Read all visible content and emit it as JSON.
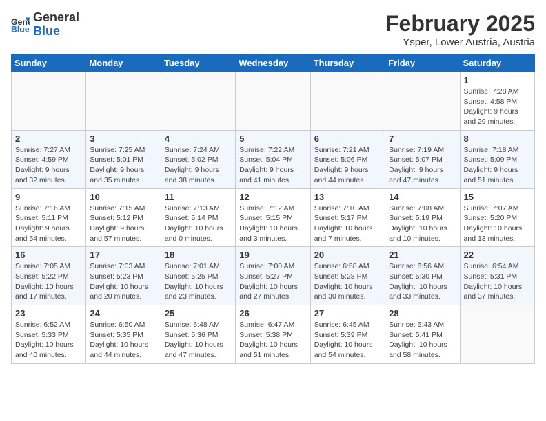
{
  "header": {
    "logo_line1": "General",
    "logo_line2": "Blue",
    "month": "February 2025",
    "location": "Ysper, Lower Austria, Austria"
  },
  "weekdays": [
    "Sunday",
    "Monday",
    "Tuesday",
    "Wednesday",
    "Thursday",
    "Friday",
    "Saturday"
  ],
  "weeks": [
    [
      {
        "day": "",
        "info": ""
      },
      {
        "day": "",
        "info": ""
      },
      {
        "day": "",
        "info": ""
      },
      {
        "day": "",
        "info": ""
      },
      {
        "day": "",
        "info": ""
      },
      {
        "day": "",
        "info": ""
      },
      {
        "day": "1",
        "info": "Sunrise: 7:28 AM\nSunset: 4:58 PM\nDaylight: 9 hours and 29 minutes."
      }
    ],
    [
      {
        "day": "2",
        "info": "Sunrise: 7:27 AM\nSunset: 4:59 PM\nDaylight: 9 hours and 32 minutes."
      },
      {
        "day": "3",
        "info": "Sunrise: 7:25 AM\nSunset: 5:01 PM\nDaylight: 9 hours and 35 minutes."
      },
      {
        "day": "4",
        "info": "Sunrise: 7:24 AM\nSunset: 5:02 PM\nDaylight: 9 hours and 38 minutes."
      },
      {
        "day": "5",
        "info": "Sunrise: 7:22 AM\nSunset: 5:04 PM\nDaylight: 9 hours and 41 minutes."
      },
      {
        "day": "6",
        "info": "Sunrise: 7:21 AM\nSunset: 5:06 PM\nDaylight: 9 hours and 44 minutes."
      },
      {
        "day": "7",
        "info": "Sunrise: 7:19 AM\nSunset: 5:07 PM\nDaylight: 9 hours and 47 minutes."
      },
      {
        "day": "8",
        "info": "Sunrise: 7:18 AM\nSunset: 5:09 PM\nDaylight: 9 hours and 51 minutes."
      }
    ],
    [
      {
        "day": "9",
        "info": "Sunrise: 7:16 AM\nSunset: 5:11 PM\nDaylight: 9 hours and 54 minutes."
      },
      {
        "day": "10",
        "info": "Sunrise: 7:15 AM\nSunset: 5:12 PM\nDaylight: 9 hours and 57 minutes."
      },
      {
        "day": "11",
        "info": "Sunrise: 7:13 AM\nSunset: 5:14 PM\nDaylight: 10 hours and 0 minutes."
      },
      {
        "day": "12",
        "info": "Sunrise: 7:12 AM\nSunset: 5:15 PM\nDaylight: 10 hours and 3 minutes."
      },
      {
        "day": "13",
        "info": "Sunrise: 7:10 AM\nSunset: 5:17 PM\nDaylight: 10 hours and 7 minutes."
      },
      {
        "day": "14",
        "info": "Sunrise: 7:08 AM\nSunset: 5:19 PM\nDaylight: 10 hours and 10 minutes."
      },
      {
        "day": "15",
        "info": "Sunrise: 7:07 AM\nSunset: 5:20 PM\nDaylight: 10 hours and 13 minutes."
      }
    ],
    [
      {
        "day": "16",
        "info": "Sunrise: 7:05 AM\nSunset: 5:22 PM\nDaylight: 10 hours and 17 minutes."
      },
      {
        "day": "17",
        "info": "Sunrise: 7:03 AM\nSunset: 5:23 PM\nDaylight: 10 hours and 20 minutes."
      },
      {
        "day": "18",
        "info": "Sunrise: 7:01 AM\nSunset: 5:25 PM\nDaylight: 10 hours and 23 minutes."
      },
      {
        "day": "19",
        "info": "Sunrise: 7:00 AM\nSunset: 5:27 PM\nDaylight: 10 hours and 27 minutes."
      },
      {
        "day": "20",
        "info": "Sunrise: 6:58 AM\nSunset: 5:28 PM\nDaylight: 10 hours and 30 minutes."
      },
      {
        "day": "21",
        "info": "Sunrise: 6:56 AM\nSunset: 5:30 PM\nDaylight: 10 hours and 33 minutes."
      },
      {
        "day": "22",
        "info": "Sunrise: 6:54 AM\nSunset: 5:31 PM\nDaylight: 10 hours and 37 minutes."
      }
    ],
    [
      {
        "day": "23",
        "info": "Sunrise: 6:52 AM\nSunset: 5:33 PM\nDaylight: 10 hours and 40 minutes."
      },
      {
        "day": "24",
        "info": "Sunrise: 6:50 AM\nSunset: 5:35 PM\nDaylight: 10 hours and 44 minutes."
      },
      {
        "day": "25",
        "info": "Sunrise: 6:48 AM\nSunset: 5:36 PM\nDaylight: 10 hours and 47 minutes."
      },
      {
        "day": "26",
        "info": "Sunrise: 6:47 AM\nSunset: 5:38 PM\nDaylight: 10 hours and 51 minutes."
      },
      {
        "day": "27",
        "info": "Sunrise: 6:45 AM\nSunset: 5:39 PM\nDaylight: 10 hours and 54 minutes."
      },
      {
        "day": "28",
        "info": "Sunrise: 6:43 AM\nSunset: 5:41 PM\nDaylight: 10 hours and 58 minutes."
      },
      {
        "day": "",
        "info": ""
      }
    ]
  ]
}
